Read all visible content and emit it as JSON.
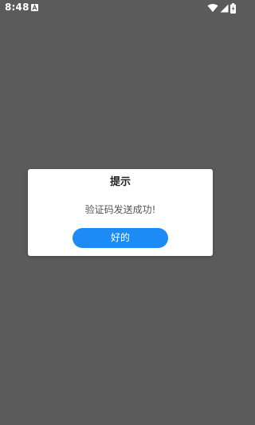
{
  "status_bar": {
    "time": "8:48",
    "icons": [
      "notification-a-icon",
      "wifi-icon",
      "cellular-signal-icon",
      "battery-charging-icon"
    ]
  },
  "dialog": {
    "title": "提示",
    "message": "验证码发送成功!",
    "ok_label": "好的"
  },
  "colors": {
    "overlay": "#5b5b5b",
    "dialog_bg": "#ffffff",
    "button_bg": "#1c8bf5",
    "button_text": "#ffffff"
  }
}
